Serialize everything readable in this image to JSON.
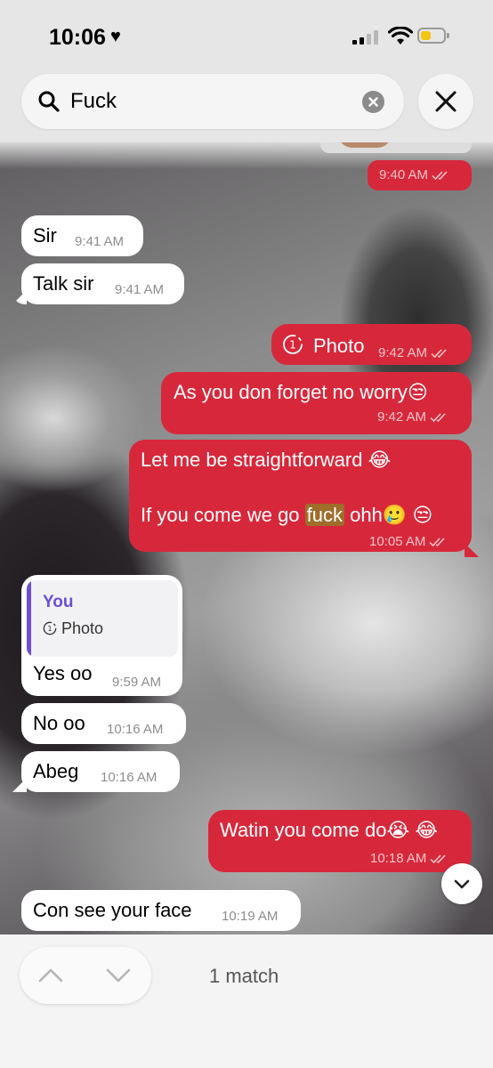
{
  "status_bar": {
    "time": "10:06",
    "heart": "♥"
  },
  "search": {
    "value": "Fuck"
  },
  "messages": [
    {
      "dir": "out",
      "time": "9:40 AM"
    },
    {
      "dir": "in",
      "text": "Sir",
      "time": "9:41 AM"
    },
    {
      "dir": "in",
      "text": "Talk sir",
      "time": "9:41 AM"
    },
    {
      "dir": "out",
      "text": "Photo",
      "time": "9:42 AM"
    },
    {
      "dir": "out",
      "text": "As you don forget no worry😒",
      "time": "9:42 AM"
    },
    {
      "dir": "out",
      "line1": "Let me be straightforward 😂",
      "line2_pre": "If you come we go ",
      "line2_match": "fuck",
      "line2_post": " ohh🥲 😒",
      "time": "10:05 AM"
    },
    {
      "dir": "in",
      "reply_author": "You",
      "reply_text": "Photo",
      "text": "Yes oo",
      "time": "9:59 AM"
    },
    {
      "dir": "in",
      "text": "No oo",
      "time": "10:16 AM"
    },
    {
      "dir": "in",
      "text": "Abeg",
      "time": "10:16 AM"
    },
    {
      "dir": "out",
      "text": "Watin you come do😭 😂",
      "time": "10:18 AM"
    },
    {
      "dir": "in",
      "text": "Con see your face",
      "time": "10:19 AM"
    }
  ],
  "search_nav": {
    "matches": "1 match"
  },
  "colors": {
    "outgoing": "#d7283b",
    "incoming": "#ffffff",
    "highlight": "#9e6e2a",
    "reply_accent": "#6c4fd6"
  },
  "icons": [
    "search-icon",
    "clear-icon",
    "close-icon",
    "read-ticks-icon",
    "timer-icon",
    "chevron-down-icon",
    "chevron-up-icon"
  ]
}
